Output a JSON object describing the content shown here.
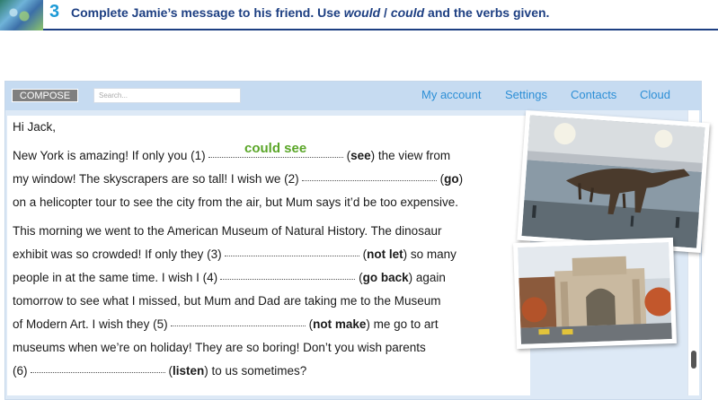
{
  "exercise": {
    "number": "3",
    "instruction_part1": "Complete Jamie’s message to his friend. Use ",
    "instruction_would": "would",
    "instruction_sep": " / ",
    "instruction_could": "could",
    "instruction_part2": " and the verbs given."
  },
  "toolbar": {
    "compose_label": "COMPOSE",
    "search_placeholder": "Search...",
    "nav": [
      "My account",
      "Settings",
      "Contacts",
      "Cloud"
    ]
  },
  "message": {
    "greeting": "Hi Jack,",
    "l1_a": "New York is amazing! If only you (1)",
    "example_answer": "could see",
    "l1_verb": "see",
    "l1_b": "the view from",
    "l2_a": "my window! The skyscrapers are so tall! I wish we (2)",
    "l2_verb": "go",
    "l3": "on a helicopter tour to see the city from the air, but Mum says it’d be too expensive.",
    "l4": "This morning we went to the American Museum of Natural History. The dinosaur",
    "l5_a": "exhibit was so crowded! If only they (3)",
    "l5_verb": "not let",
    "l5_b": "so many",
    "l6_a": "people in at the same time. I wish I (4)",
    "l6_verb": "go back",
    "l6_b": "again",
    "l7": "tomorrow to see what I missed, but Mum and Dad are taking me to the Museum",
    "l8_a": "of Modern Art. I wish they (5)",
    "l8_verb": "not make",
    "l8_b": "me go to art",
    "l9": "museums when we’re on holiday! They are so boring! Don’t you wish parents",
    "l10_a": "(6)",
    "l10_verb": "listen",
    "l10_b": "to us sometimes?"
  },
  "colors": {
    "accent_blue": "#2d8fd6",
    "answer_green": "#5aa628",
    "header_navy": "#1d3f82"
  }
}
